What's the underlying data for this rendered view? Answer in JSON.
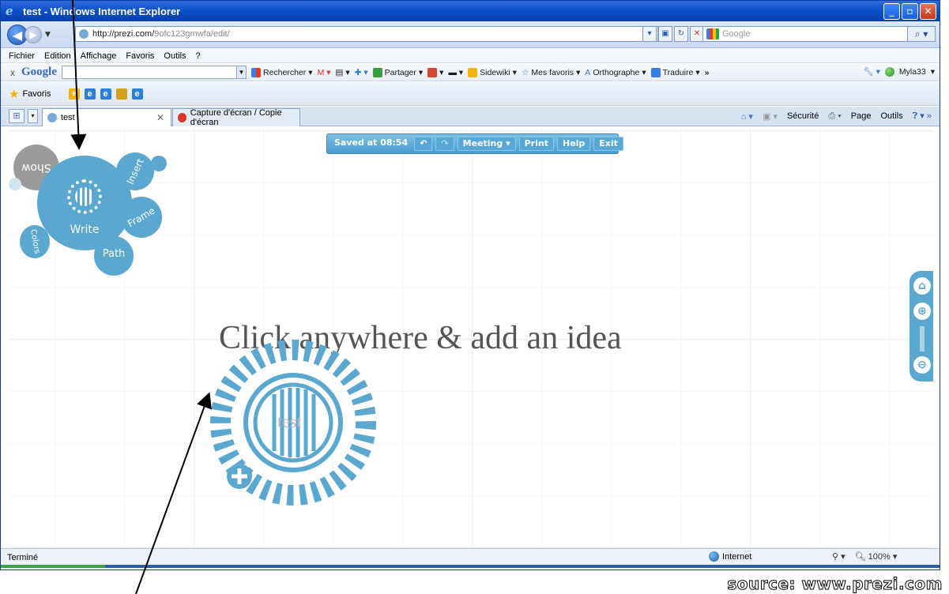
{
  "window": {
    "title": "test - Windows Internet Explorer",
    "buttons": [
      "_",
      "▫",
      "✕"
    ]
  },
  "address": {
    "url_host": "http://prezi.com/",
    "url_path": "9ofc123gmwfa/edit/",
    "search_placeholder": "Google"
  },
  "menu": [
    "Fichier",
    "Edition",
    "Affichage",
    "Favoris",
    "Outils",
    "?"
  ],
  "google_toolbar": {
    "close": "x",
    "logo": "Google",
    "items": [
      "Rechercher",
      "Partager",
      "Sidewiki",
      "Mes favoris",
      "Orthographe",
      "Traduire"
    ],
    "more": "»",
    "user": "Myla33"
  },
  "favorites": {
    "label": "Favoris"
  },
  "tabs": [
    {
      "label": "test",
      "close": "✕"
    },
    {
      "label": "Capture d'écran / Copie d'écran"
    }
  ],
  "command_bar": [
    "Sécurité",
    "Page",
    "Outils"
  ],
  "prezi_toolbar": {
    "saved": "Saved at 08:54",
    "undo": "↶",
    "redo": "↷",
    "meeting": "Meeting",
    "print": "Print",
    "help": "Help",
    "exit": "Exit"
  },
  "zebra": {
    "write": "Write",
    "insert": "Insert",
    "frame": "Frame",
    "path": "Path",
    "colors": "Colors",
    "show": "Show"
  },
  "canvas": {
    "prompt": "Click anywhere & add an idea",
    "text_object": "test"
  },
  "status": {
    "left": "Terminé",
    "zone": "Internet",
    "zoom": "100%"
  },
  "source_credit": "source: www.prezi.com",
  "colors": {
    "prezi_blue": "#5aa7cf",
    "ie_title_blue": "#0a4ec6"
  }
}
